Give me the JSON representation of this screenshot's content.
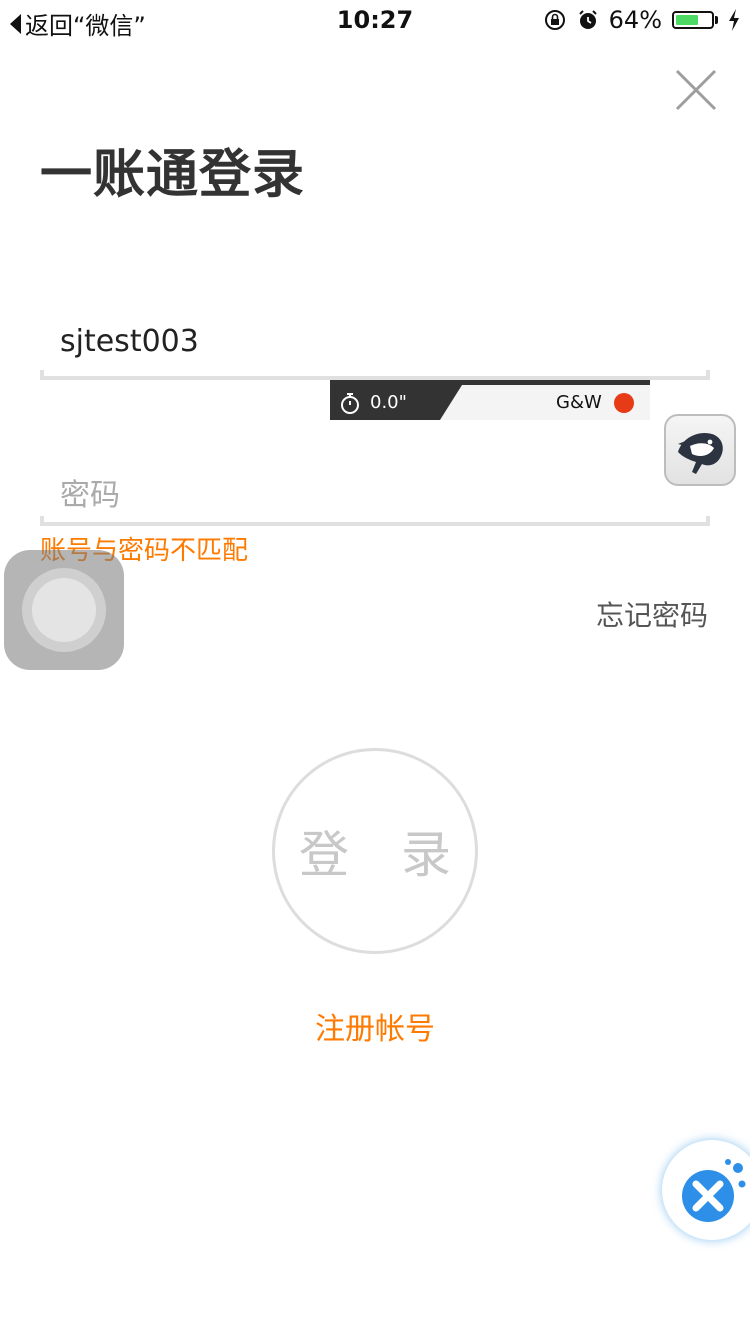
{
  "status_bar": {
    "back_text": "返回“微信”",
    "time": "10:27",
    "battery_percent": "64%",
    "battery_level": 0.64,
    "icons": [
      "orientation-lock-icon",
      "alarm-icon",
      "battery-icon",
      "charging-icon"
    ]
  },
  "title": "一账通登录",
  "account": {
    "value": "sjtest003"
  },
  "password": {
    "placeholder": "密码"
  },
  "error_message": "账号与密码不匹配",
  "forgot_password": "忘记密码",
  "login_button": "登 录",
  "register_link": "注册帐号",
  "recorder": {
    "timer": "0.0\"",
    "brand": "G&W"
  },
  "colors": {
    "accent": "#ff7a00",
    "battery": "#4cd964",
    "record": "#e63b16"
  }
}
